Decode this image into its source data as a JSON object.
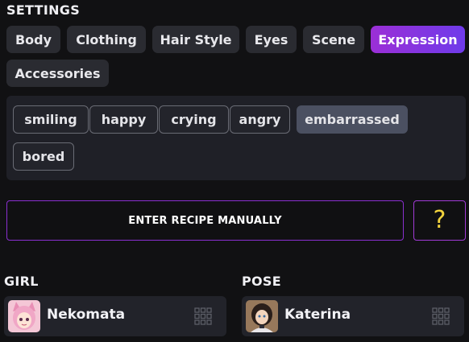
{
  "settings": {
    "title": "SETTINGS"
  },
  "tabs": [
    {
      "label": "Body",
      "active": false
    },
    {
      "label": "Clothing",
      "active": false
    },
    {
      "label": "Hair Style",
      "active": false
    },
    {
      "label": "Eyes",
      "active": false
    },
    {
      "label": "Scene",
      "active": false
    },
    {
      "label": "Expression",
      "active": true
    },
    {
      "label": "Accessories",
      "active": false
    }
  ],
  "tags": [
    {
      "label": "smiling",
      "selected": false
    },
    {
      "label": "happy",
      "selected": false
    },
    {
      "label": "crying",
      "selected": false
    },
    {
      "label": "angry",
      "selected": false
    },
    {
      "label": "embarrassed",
      "selected": true
    },
    {
      "label": "bored",
      "selected": false
    }
  ],
  "recipe": {
    "label": "ENTER RECIPE MANUALLY"
  },
  "help": {
    "glyph": "?"
  },
  "girl": {
    "section_label": "GIRL",
    "name": "Nekomata",
    "icon": "grid-icon"
  },
  "pose": {
    "section_label": "POSE",
    "name": "Katerina",
    "icon": "grid-icon"
  },
  "colors": {
    "accent_purple": "#8a2fd0",
    "active_tab_gradient_start": "#9b2fd6",
    "active_tab_gradient_end": "#6f3bea",
    "help_glyph": "#f2d33d",
    "selected_chip": "#4b5061"
  }
}
